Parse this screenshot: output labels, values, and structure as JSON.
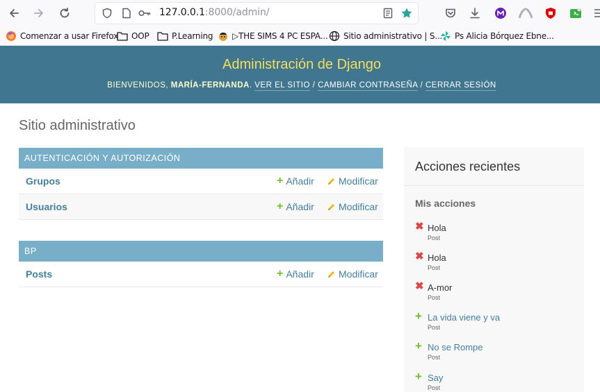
{
  "browser": {
    "url_host": "127.0.0.1",
    "url_rest": ":8000/admin/",
    "bookmarks": [
      {
        "label": "Comenzar a usar Firefox",
        "icon": "firefox-icon"
      },
      {
        "label": "OOP",
        "icon": "folder-icon"
      },
      {
        "label": "P.Learning",
        "icon": "folder-icon"
      },
      {
        "label": "▷THE SIMS 4 PC ESPA...",
        "icon": "sims-icon"
      },
      {
        "label": "Sitio administrativo | S...",
        "icon": "globe-icon"
      },
      {
        "label": "Ps Alicia Bórquez Ebne...",
        "icon": "pinwheel-icon"
      }
    ]
  },
  "header": {
    "branding": "Administración de Django",
    "welcome": "Bienvenidos,",
    "username": "María-Fernanda",
    "view_site": "Ver el sitio",
    "change_password": "Cambiar contraseña",
    "logout": "Cerrar sesión",
    "separator": "/"
  },
  "content": {
    "title": "Sitio administrativo",
    "add_label": "Añadir",
    "change_label": "Modificar",
    "modules": [
      {
        "caption": "Autenticación y autorización",
        "models": [
          "Grupos",
          "Usuarios"
        ]
      },
      {
        "caption": "BP",
        "models": [
          "Posts"
        ]
      }
    ]
  },
  "recent_actions": {
    "title": "Acciones recientes",
    "subtitle": "Mis acciones",
    "items": [
      {
        "kind": "delete",
        "title": "Hola",
        "type": "Post"
      },
      {
        "kind": "delete",
        "title": "Hola",
        "type": "Post"
      },
      {
        "kind": "delete",
        "title": "A-mor",
        "type": "Post"
      },
      {
        "kind": "add",
        "title": "La vida viene y va",
        "type": "Post"
      },
      {
        "kind": "add",
        "title": "No se Rompe",
        "type": "Post"
      },
      {
        "kind": "add",
        "title": "Say",
        "type": "Post"
      }
    ]
  },
  "colors": {
    "header_bg": "#417690",
    "branding": "#f5dd5d",
    "caption_bg": "#79aec8",
    "link": "#447e9b",
    "add_green": "#70bf2b",
    "delete_red": "#dd4646"
  }
}
